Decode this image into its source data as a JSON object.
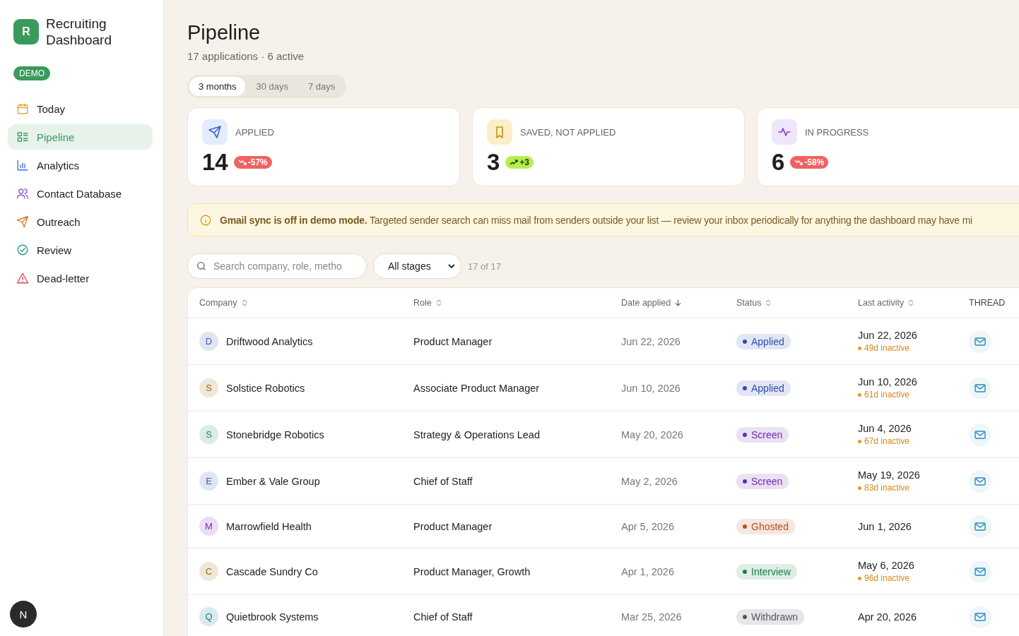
{
  "app": {
    "logo_letter": "R",
    "title": "Recruiting Dashboard",
    "badge": "DEMO"
  },
  "nav": [
    {
      "label": "Today",
      "kind": "calendar",
      "selected": false
    },
    {
      "label": "Pipeline",
      "kind": "list",
      "selected": true
    },
    {
      "label": "Analytics",
      "kind": "chart",
      "selected": false
    },
    {
      "label": "Contact Database",
      "kind": "people",
      "selected": false
    },
    {
      "label": "Outreach",
      "kind": "send",
      "selected": false
    },
    {
      "label": "Review",
      "kind": "check",
      "selected": false
    },
    {
      "label": "Dead-letter",
      "kind": "warning",
      "selected": false
    }
  ],
  "user": {
    "initial": "N"
  },
  "page": {
    "title": "Pipeline",
    "subtitle": "17 applications · 6 active"
  },
  "ranges": [
    {
      "label": "3 months",
      "selected": true
    },
    {
      "label": "30 days",
      "selected": false
    },
    {
      "label": "7 days",
      "selected": false
    }
  ],
  "stats": [
    {
      "label": "APPLIED",
      "value": "14",
      "kind": "send",
      "delta": {
        "text": "-57%",
        "kind": "down"
      }
    },
    {
      "label": "SAVED, NOT APPLIED",
      "value": "3",
      "kind": "bookmark",
      "delta": {
        "text": "+3",
        "kind": "up"
      }
    },
    {
      "label": "IN PROGRESS",
      "value": "6",
      "kind": "pulse",
      "delta": {
        "text": "-58%",
        "kind": "down"
      }
    }
  ],
  "notice": {
    "text": "**Gmail sync is off in demo mode.** Targeted sender search can miss mail from senders outside your list — review your inbox periodically for anything the dashboard may have mi"
  },
  "filters": {
    "search_placeholder": "Search company, role, metho",
    "stage": "All stages",
    "count": "17 of 17"
  },
  "table": {
    "columns": [
      {
        "label": "Company",
        "kind": "sortable"
      },
      {
        "label": "Role",
        "kind": "sortable"
      },
      {
        "label": "Date applied",
        "kind": "sorted"
      },
      {
        "label": "Status",
        "kind": "sortable"
      },
      {
        "label": "Last activity",
        "kind": "sortable"
      },
      {
        "label": "THREAD",
        "kind": "plain"
      }
    ],
    "rows": [
      {
        "initial": "D",
        "color": "#3b5bb5",
        "company": "Driftwood Analytics",
        "role": "Product Manager",
        "date": "Jun 22, 2026",
        "status": {
          "label": "Applied",
          "color": "#2f4fb0"
        },
        "last": "Jun 22, 2026",
        "inactive": "49d inactive"
      },
      {
        "initial": "S",
        "color": "#9a6a10",
        "company": "Solstice Robotics",
        "role": "Associate Product Manager",
        "date": "Jun 10, 2026",
        "status": {
          "label": "Applied",
          "color": "#2f4fb0"
        },
        "last": "Jun 10, 2026",
        "inactive": "61d inactive"
      },
      {
        "initial": "S",
        "color": "#1f8a5a",
        "company": "Stonebridge Robotics",
        "role": "Strategy & Operations Lead",
        "date": "May 20, 2026",
        "status": {
          "label": "Screen",
          "color": "#6a2bb0"
        },
        "last": "Jun 4, 2026",
        "inactive": "67d inactive"
      },
      {
        "initial": "E",
        "color": "#3b5bb5",
        "company": "Ember & Vale Group",
        "role": "Chief of Staff",
        "date": "May 2, 2026",
        "status": {
          "label": "Screen",
          "color": "#6a2bb0"
        },
        "last": "May 19, 2026",
        "inactive": "83d inactive"
      },
      {
        "initial": "M",
        "color": "#7a2bc0",
        "company": "Marrowfield Health",
        "role": "Product Manager",
        "date": "Apr 5, 2026",
        "status": {
          "label": "Ghosted",
          "color": "#b8501a"
        },
        "last": "Jun 1, 2026"
      },
      {
        "initial": "C",
        "color": "#9a6a10",
        "company": "Cascade Sundry Co",
        "role": "Product Manager, Growth",
        "date": "Apr 1, 2026",
        "status": {
          "label": "Interview",
          "color": "#17804a"
        },
        "last": "May 6, 2026",
        "inactive": "96d inactive"
      },
      {
        "initial": "Q",
        "color": "#127a8a",
        "company": "Quietbrook Systems",
        "role": "Chief of Staff",
        "date": "Mar 25, 2026",
        "status": {
          "label": "Withdrawn",
          "color": "#555560"
        },
        "last": "Apr 20, 2026"
      }
    ]
  }
}
